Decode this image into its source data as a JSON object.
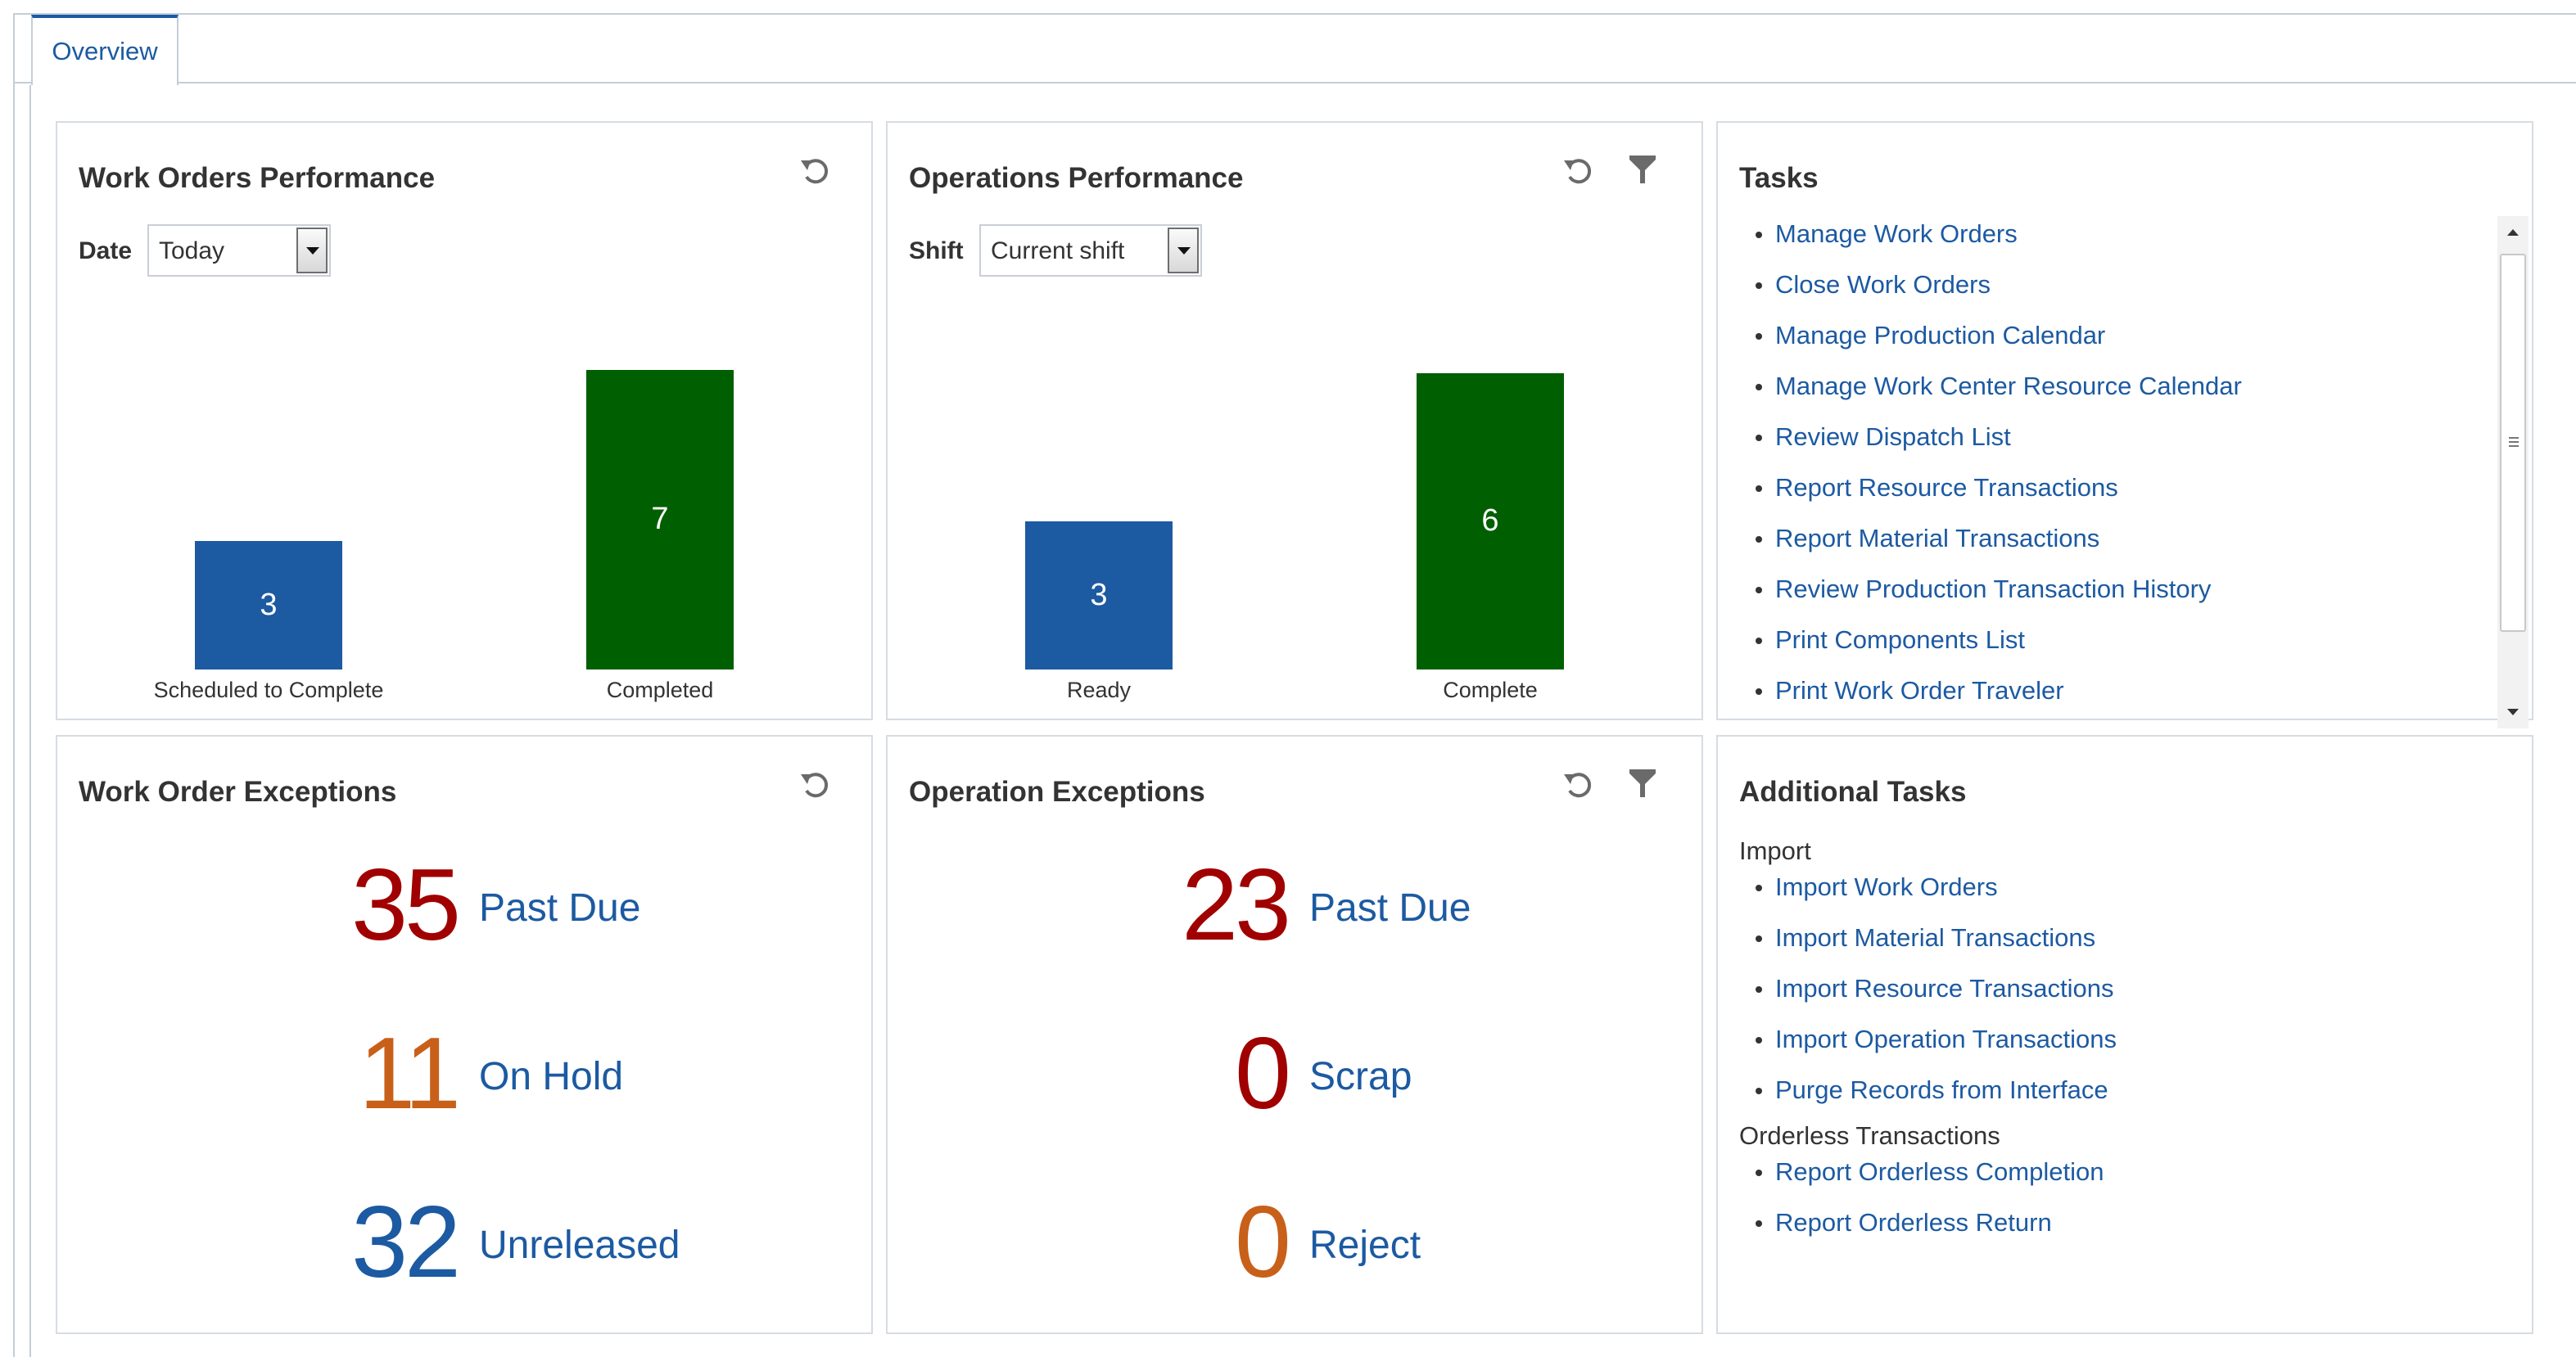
{
  "tabs": [
    {
      "label": "Overview",
      "active": true
    }
  ],
  "work_orders_performance": {
    "title": "Work Orders Performance",
    "filter_label": "Date",
    "filter_value": "Today",
    "chart_data": {
      "type": "bar",
      "categories": [
        "Scheduled to Complete",
        "Completed"
      ],
      "values": [
        3,
        7
      ],
      "colors": [
        "#1c5aa2",
        "#005f00"
      ],
      "ylim": [
        0,
        7.5
      ]
    }
  },
  "operations_performance": {
    "title": "Operations Performance",
    "filter_label": "Shift",
    "filter_value": "Current shift",
    "chart_data": {
      "type": "bar",
      "categories": [
        "Ready",
        "Complete"
      ],
      "values": [
        3,
        6
      ],
      "colors": [
        "#1c5aa2",
        "#005f00"
      ],
      "ylim": [
        0,
        6.5
      ]
    }
  },
  "tasks": {
    "title": "Tasks",
    "items": [
      "Manage Work Orders",
      "Close Work Orders",
      "Manage Production Calendar",
      "Manage Work Center Resource Calendar",
      "Review Dispatch List",
      "Report Resource Transactions",
      "Report Material Transactions",
      "Review Production Transaction History",
      "Print Components List",
      "Print Work Order Traveler"
    ]
  },
  "work_order_exceptions": {
    "title": "Work Order Exceptions",
    "rows": [
      {
        "count": "35",
        "label": "Past Due",
        "color": "#a00000"
      },
      {
        "count": "11",
        "label": "On Hold",
        "color": "#c8601a"
      },
      {
        "count": "32",
        "label": "Unreleased",
        "color": "#1c5aa2"
      }
    ]
  },
  "operation_exceptions": {
    "title": "Operation Exceptions",
    "rows": [
      {
        "count": "23",
        "label": "Past Due",
        "color": "#a00000"
      },
      {
        "count": "0",
        "label": "Scrap",
        "color": "#a00000"
      },
      {
        "count": "0",
        "label": "Reject",
        "color": "#c8601a"
      }
    ]
  },
  "additional_tasks": {
    "title": "Additional Tasks",
    "groups": [
      {
        "label": "Import",
        "items": [
          "Import Work Orders",
          "Import Material Transactions",
          "Import Resource Transactions",
          "Import Operation Transactions",
          "Purge Records from Interface"
        ]
      },
      {
        "label": "Orderless Transactions",
        "items": [
          "Report Orderless Completion",
          "Report Orderless Return"
        ]
      }
    ]
  }
}
